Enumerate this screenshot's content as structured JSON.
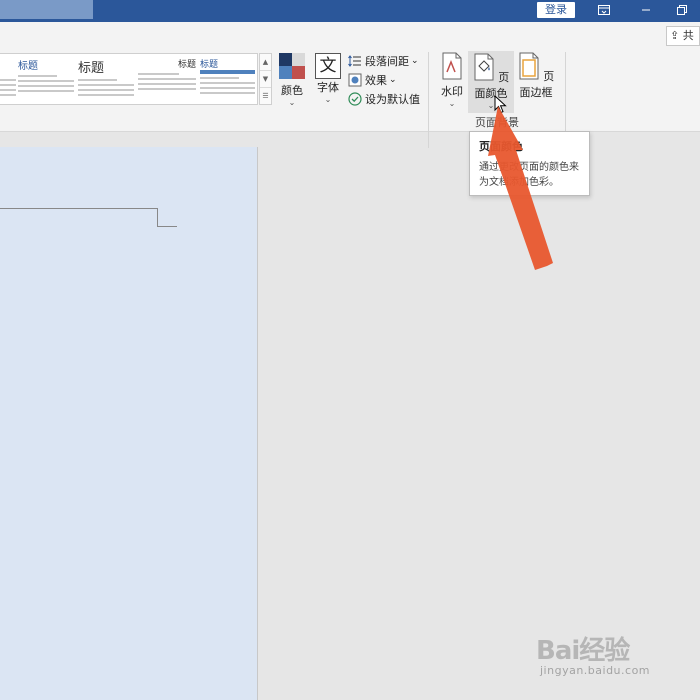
{
  "titlebar": {
    "login_label": "登录",
    "colors": {
      "bar": "#2b579a"
    }
  },
  "ribbon": {
    "share_label": "共",
    "styles_gallery": {
      "thumbs": [
        {
          "heading": "标题"
        },
        {
          "heading": "标题"
        },
        {
          "heading": "标题"
        },
        {
          "heading": "标题"
        }
      ]
    },
    "colors_button": {
      "label": "颜色"
    },
    "fonts_button": {
      "label": "字体",
      "glyph": "文"
    },
    "paragraph_spacing": {
      "label": "段落间距"
    },
    "effects": {
      "label": "效果"
    },
    "set_default": {
      "label": "设为默认值"
    },
    "watermark_button": {
      "label": "水印"
    },
    "page_color_button": {
      "label": "页面颜色"
    },
    "page_borders_button": {
      "label": "页面边框"
    },
    "group_label": "页面背景"
  },
  "tooltip": {
    "title": "页面颜色",
    "description": "通过更改页面的颜色来为文档添加色彩。"
  },
  "document": {
    "page_color": "#dbe5f3"
  },
  "annotation": {
    "arrow_color": "#e8572e"
  },
  "watermark": {
    "main": "Bai经验",
    "sub": "jingyan.baidu.com"
  }
}
